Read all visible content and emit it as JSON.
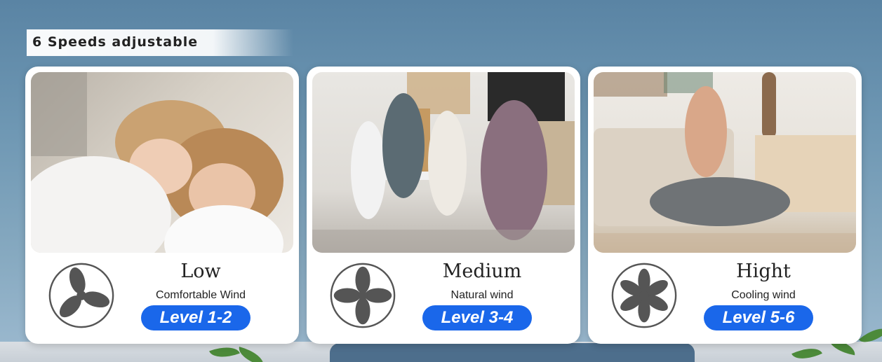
{
  "banner": {
    "text": "6 Speeds adjustable"
  },
  "cards": [
    {
      "title": "Low",
      "subtitle": "Comfortable Wind",
      "level": "Level 1-2",
      "icon": "fan-icon"
    },
    {
      "title": "Medium",
      "subtitle": "Natural wind",
      "level": "Level 3-4",
      "icon": "fan-icon"
    },
    {
      "title": "Hight",
      "subtitle": "Cooling wind",
      "level": "Level 5-6",
      "icon": "fan-icon"
    }
  ],
  "colors": {
    "accent": "#1a67ea",
    "background": "#6e97b3",
    "fan": "#555555"
  }
}
